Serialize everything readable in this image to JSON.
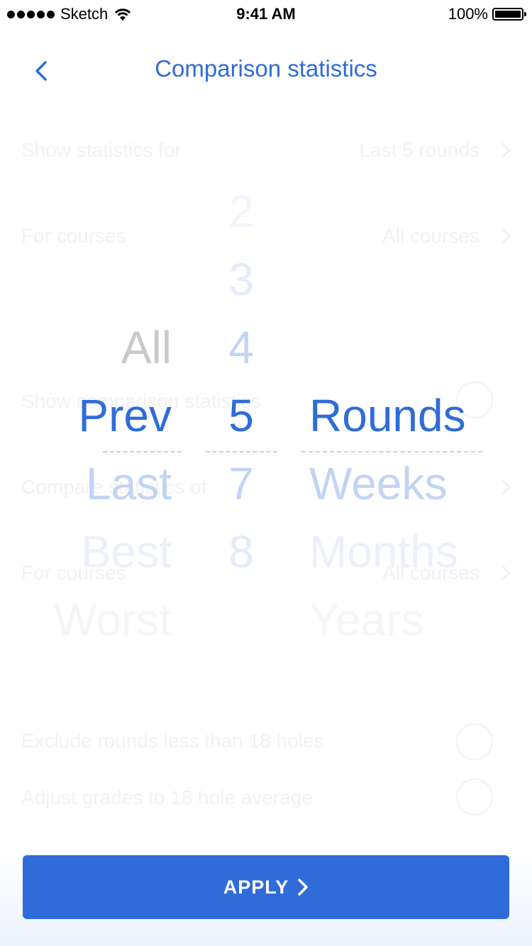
{
  "status_bar": {
    "carrier": "Sketch",
    "time": "9:41 AM",
    "battery": "100%"
  },
  "nav": {
    "title": "Comparison statistics",
    "back_icon": "chevron-left-icon"
  },
  "background_rows": [
    {
      "label": "Show statistics for",
      "value": "Last 5 rounds"
    },
    {
      "label": "For courses",
      "value": "All courses"
    },
    {
      "label": "Show comparison statistics",
      "value": ""
    },
    {
      "label": "Compare statistics of",
      "value": ""
    },
    {
      "label": "For courses",
      "value": "All courses"
    },
    {
      "label": "Exclude rounds less than 18 holes",
      "value": ""
    },
    {
      "label": "Adjust grades to 18 hole average",
      "value": ""
    }
  ],
  "picker": {
    "column1": {
      "items": [
        "All",
        "Prev",
        "Last",
        "Best",
        "Worst"
      ],
      "selected": "Prev"
    },
    "column2": {
      "items": [
        "2",
        "3",
        "4",
        "5",
        "7",
        "8"
      ],
      "selected": "5"
    },
    "column3": {
      "items": [
        "Rounds",
        "Weeks",
        "Months",
        "Years"
      ],
      "selected": "Rounds"
    }
  },
  "apply_button": {
    "label": "APPLY",
    "icon": "chevron-right-icon"
  },
  "colors": {
    "accent": "#2f6cd9",
    "inactive_gray": "#c8c8c8"
  }
}
